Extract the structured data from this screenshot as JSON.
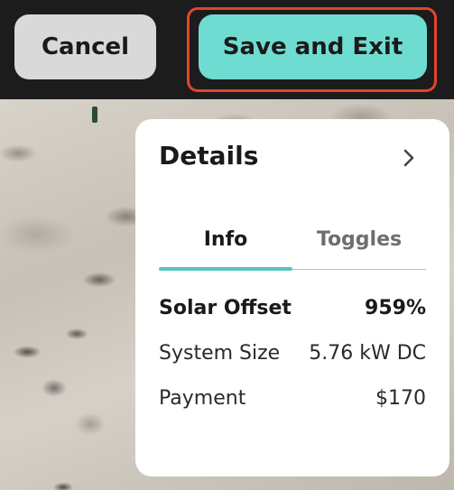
{
  "toolbar": {
    "cancel_label": "Cancel",
    "save_label": "Save and Exit",
    "save_color": "#6fdcd2",
    "highlight_color": "#e0462c"
  },
  "details": {
    "title": "Details",
    "expand_icon": "chevron-right-icon",
    "tabs": [
      {
        "label": "Info",
        "active": true
      },
      {
        "label": "Toggles",
        "active": false
      }
    ],
    "tab_accent_color": "#5bc4bc",
    "rows": [
      {
        "label": "Solar Offset",
        "value": "959%",
        "emphasis": true
      },
      {
        "label": "System Size",
        "value": "5.76 kW DC",
        "emphasis": false
      },
      {
        "label": "Payment",
        "value": "$170",
        "emphasis": false
      }
    ]
  }
}
